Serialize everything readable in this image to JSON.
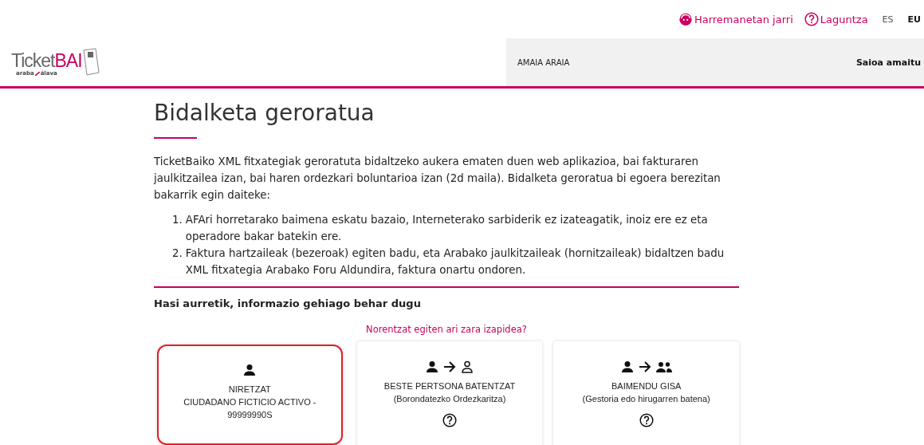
{
  "top_links": [
    {
      "kind": "contact",
      "label": "Harremanetan jarri"
    },
    {
      "kind": "help",
      "label": "Laguntza"
    }
  ],
  "languages": [
    {
      "label": "ES",
      "selected": false
    },
    {
      "label": "EU",
      "selected": true
    }
  ],
  "logo": {
    "word": "Ticket",
    "accent": "BAI",
    "region_left": "araba",
    "region_right": "álava"
  },
  "user_bar": {
    "user": "AMAIA ARAIA",
    "logout": "Saioa amaitu"
  },
  "title": "Bidalketa geroratua",
  "intro": "TicketBaiko XML fitxategiak geroratuta bidaltzeko aukera ematen duen web aplikazioa, bai fakturaren jaulkitzailea izan, bai haren ordezkari boluntarioa izan (2d maila). Bidalketa geroratua bi egoera berezitan bakarrik egin daiteke:",
  "conditions": [
    {
      "number": "1.",
      "text": "AFAri horretarako baimena eskatu bazaio, Interneterako sarbiderik ez izateagatik, inoiz ere ez eta operadore bakar batekin ere."
    },
    {
      "number": "2.",
      "text": "Faktura hartzaileak (bezeroak) egiten badu, eta Arabako jaulkitzaileak (hornitzaileak) bidaltzen badu XML fitxategia Arabako Foru Aldundira, faktura onartu ondoren."
    }
  ],
  "section_heading": "Hasi aurretik, informazio gehiago behar dugu",
  "question": "Norentzat egiten ari zara izapidea?",
  "options": [
    {
      "kind": "self",
      "title": "NIRETZAT",
      "subtitle": "CIUDADANO FICTICIO ACTIVO - 99999990S",
      "help": false,
      "selected": true
    },
    {
      "kind": "other",
      "title": "BESTE PERTSONA BATENTZAT",
      "subtitle": "(Borondatezko Ordezkaritza)",
      "help": true,
      "selected": false
    },
    {
      "kind": "agent",
      "title": "BAIMENDU GISA",
      "subtitle": "(Gestoria edo hirugarren batena)",
      "help": true,
      "selected": false
    }
  ]
}
